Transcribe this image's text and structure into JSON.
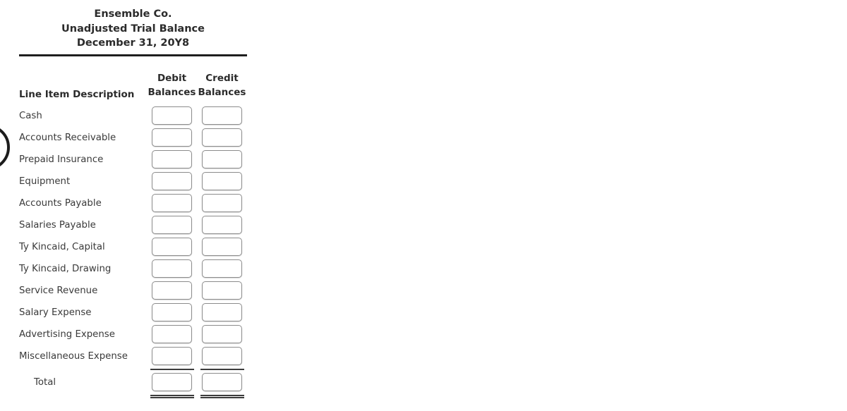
{
  "document": {
    "company": "Ensemble Co.",
    "statement_title": "Unadjusted Trial Balance",
    "date": "December 31, 20Y8"
  },
  "table": {
    "headers": {
      "description": "Line Item Description",
      "debit_line1": "Debit",
      "debit_line2": "Balances",
      "credit_line1": "Credit",
      "credit_line2": "Balances"
    },
    "rows": [
      {
        "label": "Cash",
        "debit": "",
        "credit": ""
      },
      {
        "label": "Accounts Receivable",
        "debit": "",
        "credit": ""
      },
      {
        "label": "Prepaid Insurance",
        "debit": "",
        "credit": ""
      },
      {
        "label": "Equipment",
        "debit": "",
        "credit": ""
      },
      {
        "label": "Accounts Payable",
        "debit": "",
        "credit": ""
      },
      {
        "label": "Salaries Payable",
        "debit": "",
        "credit": ""
      },
      {
        "label": "Ty Kincaid, Capital",
        "debit": "",
        "credit": ""
      },
      {
        "label": "Ty Kincaid, Drawing",
        "debit": "",
        "credit": ""
      },
      {
        "label": "Service Revenue",
        "debit": "",
        "credit": ""
      },
      {
        "label": "Salary Expense",
        "debit": "",
        "credit": ""
      },
      {
        "label": "Advertising Expense",
        "debit": "",
        "credit": ""
      },
      {
        "label": "Miscellaneous Expense",
        "debit": "",
        "credit": ""
      }
    ],
    "total_row": {
      "label": "Total",
      "debit": "",
      "credit": ""
    }
  },
  "overlay": {
    "spinner_icon": "loading-circle-icon"
  },
  "colors": {
    "text": "#333333",
    "heading": "#2b2b2b",
    "rule": "#1f1f1f",
    "box_border": "#8c8c8c",
    "background": "#ffffff"
  }
}
